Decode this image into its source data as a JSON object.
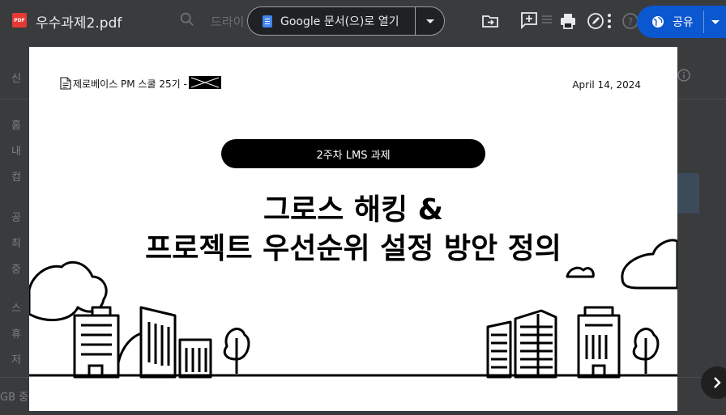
{
  "topbar": {
    "file_type": "PDF",
    "file_name": "우수과제2.pdf",
    "search_hint": "드라이",
    "open_with_label": "Google 문서(으)로 열기",
    "share_label": "공유"
  },
  "background_nav": [
    "신",
    "홈",
    "내",
    "컴",
    "공",
    "최",
    "중",
    "스",
    "휴",
    "저"
  ],
  "background_footer": "GB 중",
  "document": {
    "header": "제로베이스 PM 스쿨 25기 -",
    "date": "April 14, 2024",
    "pill_label": "2주차 LMS 과제",
    "title_line1": "그로스 해킹 &",
    "title_line2": "프로젝트 우선순위 설정 방안 정의"
  }
}
